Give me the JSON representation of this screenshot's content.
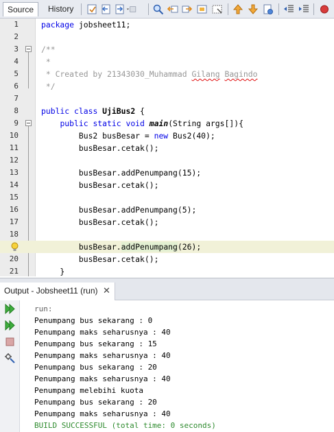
{
  "editor_tabs": {
    "source": "Source",
    "history": "History"
  },
  "toolbar_icons": [
    "last-edit-icon",
    "back-icon",
    "forward-icon",
    "find-icon",
    "find-previous-icon",
    "find-next-icon",
    "find-selection-icon",
    "toggle-highlight-icon",
    "previous-bookmark-icon",
    "next-bookmark-icon",
    "toggle-bookmark-icon",
    "shift-left-icon",
    "shift-right-icon",
    "stop-macro-icon"
  ],
  "code_lines": [
    {
      "n": "1",
      "t": "package jobsheet11;"
    },
    {
      "n": "2",
      "t": ""
    },
    {
      "n": "3",
      "t": "/**"
    },
    {
      "n": "4",
      "t": " *"
    },
    {
      "n": "5",
      "t": " * Created by 21343030_Muhammad Gilang Bagindo"
    },
    {
      "n": "6",
      "t": " */"
    },
    {
      "n": "7",
      "t": ""
    },
    {
      "n": "8",
      "t": "public class UjiBus2 {"
    },
    {
      "n": "9",
      "t": "    public static void main(String args[]){"
    },
    {
      "n": "10",
      "t": "        Bus2 busBesar = new Bus2(40);"
    },
    {
      "n": "11",
      "t": "        busBesar.cetak();"
    },
    {
      "n": "12",
      "t": ""
    },
    {
      "n": "13",
      "t": "        busBesar.addPenumpang(15);"
    },
    {
      "n": "14",
      "t": "        busBesar.cetak();"
    },
    {
      "n": "15",
      "t": ""
    },
    {
      "n": "16",
      "t": "        busBesar.addPenumpang(5);"
    },
    {
      "n": "17",
      "t": "        busBesar.cetak();"
    },
    {
      "n": "18",
      "t": ""
    },
    {
      "n": "19",
      "t": "        busBesar.addPenumpang(26);"
    },
    {
      "n": "20",
      "t": "        busBesar.cetak();"
    },
    {
      "n": "21",
      "t": "    }"
    }
  ],
  "output": {
    "tab_title": "Output - Jobsheet11 (run)",
    "close_glyph": "✕",
    "lines": [
      "run:",
      "Penumpang bus sekarang : 0",
      "Penumpang maks seharusnya : 40",
      "Penumpang bus sekarang : 15",
      "Penumpang maks seharusnya : 40",
      "Penumpang bus sekarang : 20",
      "Penumpang maks seharusnya : 40",
      "Penumpang melebihi kuota",
      "Penumpang bus sekarang : 20",
      "Penumpang maks seharusnya : 40",
      "BUILD SUCCESSFUL (total time: 0 seconds)"
    ]
  },
  "colors": {
    "keyword": "#0000e6",
    "comment": "#969696",
    "success": "#2d8a2d"
  }
}
